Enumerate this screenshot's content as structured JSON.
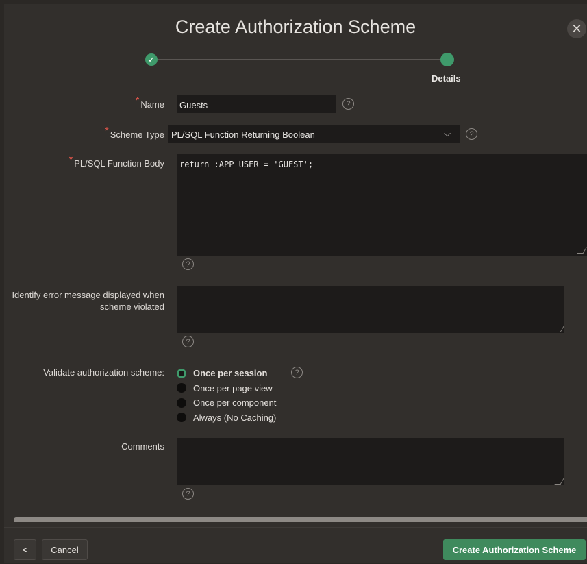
{
  "dialog": {
    "title": "Create Authorization Scheme",
    "close_symbol": "✕"
  },
  "wizard": {
    "step1_check": "✓",
    "step2_label": "Details"
  },
  "form": {
    "required_marker": "*",
    "help_symbol": "?",
    "name": {
      "label": "Name",
      "value": "Guests"
    },
    "scheme_type": {
      "label": "Scheme Type",
      "value": "PL/SQL Function Returning Boolean",
      "chevron": "⌵"
    },
    "function_body": {
      "label": "PL/SQL Function Body",
      "value": "return :APP_USER = 'GUEST';"
    },
    "error_message": {
      "label": "Identify error message displayed when scheme violated",
      "value": ""
    },
    "validate": {
      "label": "Validate authorization scheme:",
      "options": [
        {
          "label": "Once per session",
          "selected": true
        },
        {
          "label": "Once per page view",
          "selected": false
        },
        {
          "label": "Once per component",
          "selected": false
        },
        {
          "label": "Always (No Caching)",
          "selected": false
        }
      ]
    },
    "comments": {
      "label": "Comments",
      "value": ""
    }
  },
  "footer": {
    "back_symbol": "<",
    "cancel_label": "Cancel",
    "create_label": "Create Authorization Scheme"
  },
  "colors": {
    "accent": "#3f9a6b",
    "primary_button": "#3f8a5d",
    "required": "#e0564b",
    "background": "#322f2c",
    "field": "#1d1b1a"
  }
}
